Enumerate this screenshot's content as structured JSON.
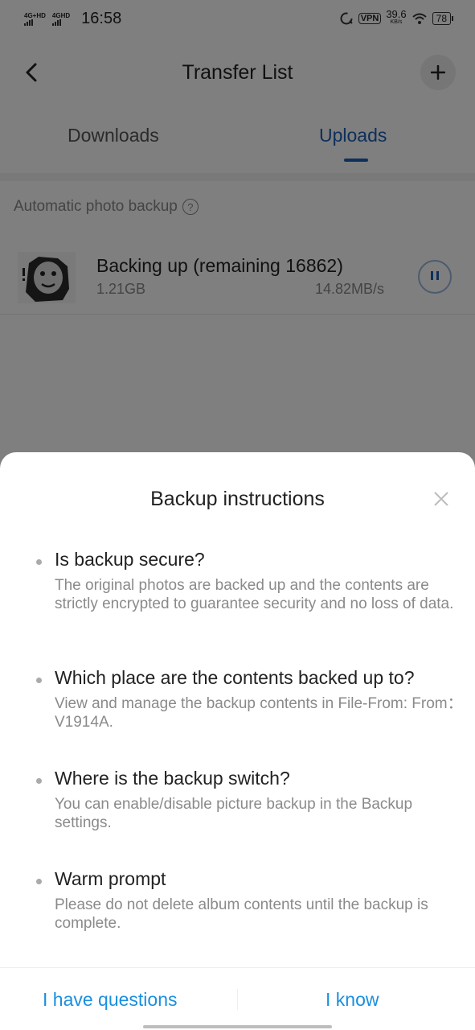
{
  "status_bar": {
    "sim1_label": "4G+HD",
    "sim2_label": "4GHD",
    "time": "16:58",
    "vpn_label": "VPN",
    "net_speed_value": "39.6",
    "net_speed_unit": "KB/s",
    "battery": "78"
  },
  "header": {
    "title": "Transfer List",
    "add_label": "+"
  },
  "tabs": [
    {
      "label": "Downloads",
      "active": false
    },
    {
      "label": "Uploads",
      "active": true
    }
  ],
  "section": {
    "title": "Automatic photo backup",
    "help_label": "?"
  },
  "backup_item": {
    "title": "Backing up (remaining 16862)",
    "size": "1.21GB",
    "speed": "14.82MB/s"
  },
  "sheet": {
    "title": "Backup instructions",
    "faqs": [
      {
        "question": "Is backup secure?",
        "answer": "The original photos are backed up and the contents are strictly encrypted to guarantee security and no loss of data."
      },
      {
        "question": "Which place are the contents backed up to?",
        "answer": "View and manage the backup contents in File-From: From：V1914A."
      },
      {
        "question": "Where is the backup switch?",
        "answer": "You can enable/disable picture backup in the Backup settings."
      },
      {
        "question": "Warm prompt",
        "answer": "Please do not delete album contents until the backup is complete."
      }
    ],
    "btn_questions": "I have questions",
    "btn_know": "I know"
  },
  "colors": {
    "accent": "#1a5fb4",
    "link": "#1a8fe0",
    "overlay": "rgba(0,0,0,0.5)"
  }
}
